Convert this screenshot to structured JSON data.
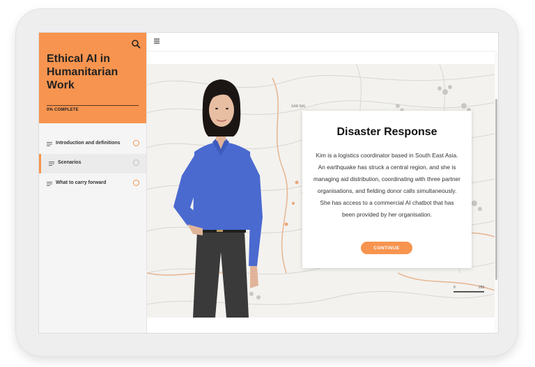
{
  "course": {
    "title": "Ethical AI in Humanitarian Work",
    "progress_label": "0% COMPLETE"
  },
  "sidebar": {
    "items": [
      {
        "label": "Introduction and definitions",
        "state": "in-progress"
      },
      {
        "label": "Scenarios",
        "state": "active"
      },
      {
        "label": "What to carry forward",
        "state": "in-progress"
      }
    ]
  },
  "map": {
    "label_top": "SAN NAI",
    "scale_start": "0",
    "scale_end": "250"
  },
  "card": {
    "title": "Disaster Response",
    "body": "Kim is a logistics coordinator based in South East Asia. An earthquake has struck a central region, and she is managing aid distribution, coordinating with three partner organisations, and fielding donor calls simultaneously. She has access to a commercial AI chatbot that has been provided by her organisation.",
    "button_label": "CONTINUE"
  },
  "colors": {
    "accent": "#f7944f",
    "shirt": "#4a6ad0",
    "pants": "#3a3a3a"
  },
  "icons": {
    "search": "search-icon",
    "menu": "hamburger-menu-icon",
    "lesson": "lesson-lines-icon",
    "status": "progress-ring-icon"
  }
}
